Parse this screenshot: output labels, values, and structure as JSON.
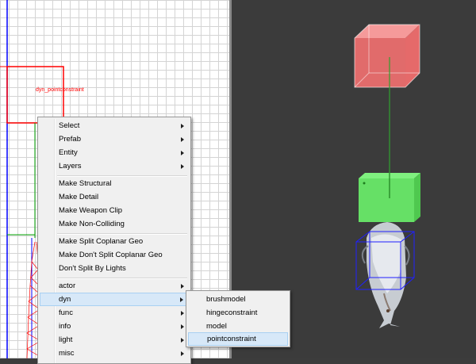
{
  "grid_view": {
    "entity_label": "dyn_pointconstraint",
    "colors": {
      "selection": "#ff0000",
      "axis_vertical": "#0000ff",
      "entity_line": "#00a000"
    }
  },
  "persp_view": {
    "colors": {
      "top_box": "#f07070",
      "bottom_box": "#66e066",
      "tether": "#2fa02f",
      "model_bounds": "#1f1fff"
    }
  },
  "context_menu": {
    "items": [
      {
        "label": "Select",
        "submenu": true
      },
      {
        "label": "Prefab",
        "submenu": true
      },
      {
        "label": "Entity",
        "submenu": true
      },
      {
        "label": "Layers",
        "submenu": true
      },
      {
        "label": "Make Structural",
        "submenu": false
      },
      {
        "label": "Make Detail",
        "submenu": false
      },
      {
        "label": "Make Weapon Clip",
        "submenu": false
      },
      {
        "label": "Make Non-Colliding",
        "submenu": false
      },
      {
        "label": "Make Split Coplanar Geo",
        "submenu": false
      },
      {
        "label": "Make Don't Split Coplanar Geo",
        "submenu": false
      },
      {
        "label": "Don't Split By Lights",
        "submenu": false
      },
      {
        "label": "actor",
        "submenu": true
      },
      {
        "label": "dyn",
        "submenu": true,
        "highlighted": true
      },
      {
        "label": "func",
        "submenu": true
      },
      {
        "label": "info",
        "submenu": true
      },
      {
        "label": "light",
        "submenu": true
      },
      {
        "label": "misc",
        "submenu": true
      }
    ]
  },
  "dyn_submenu": {
    "items": [
      {
        "label": "brushmodel"
      },
      {
        "label": "hingeconstraint"
      },
      {
        "label": "model"
      },
      {
        "label": "pointconstraint",
        "highlighted": true
      }
    ]
  }
}
